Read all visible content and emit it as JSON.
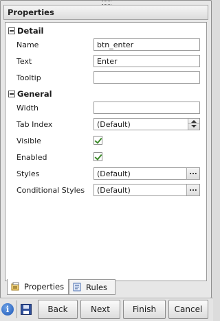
{
  "window": {
    "title": "Properties"
  },
  "sections": {
    "detail": {
      "label": "Detail",
      "rows": {
        "name": {
          "label": "Name",
          "value": "btn_enter"
        },
        "text": {
          "label": "Text",
          "value": "Enter"
        },
        "tooltip": {
          "label": "Tooltip",
          "value": ""
        }
      }
    },
    "general": {
      "label": "General",
      "rows": {
        "width": {
          "label": "Width",
          "value": ""
        },
        "tab_index": {
          "label": "Tab Index",
          "value": "(Default)"
        },
        "visible": {
          "label": "Visible",
          "checked": true
        },
        "enabled": {
          "label": "Enabled",
          "checked": true
        },
        "styles": {
          "label": "Styles",
          "value": "(Default)"
        },
        "conditional_styles": {
          "label": "Conditional Styles",
          "value": "(Default)"
        }
      }
    }
  },
  "ellipsis": "...",
  "tabs": [
    {
      "label": "Properties",
      "icon": "properties-icon",
      "active": true
    },
    {
      "label": "Rules",
      "icon": "rules-icon",
      "active": false
    }
  ],
  "footer": {
    "info_icon_glyph": "i",
    "back": "Back",
    "next": "Next",
    "finish": "Finish",
    "cancel": "Cancel"
  },
  "colors": {
    "checkmark": "#3b8a2a",
    "info": "#1b55b6",
    "save": "#2f4f9a"
  }
}
